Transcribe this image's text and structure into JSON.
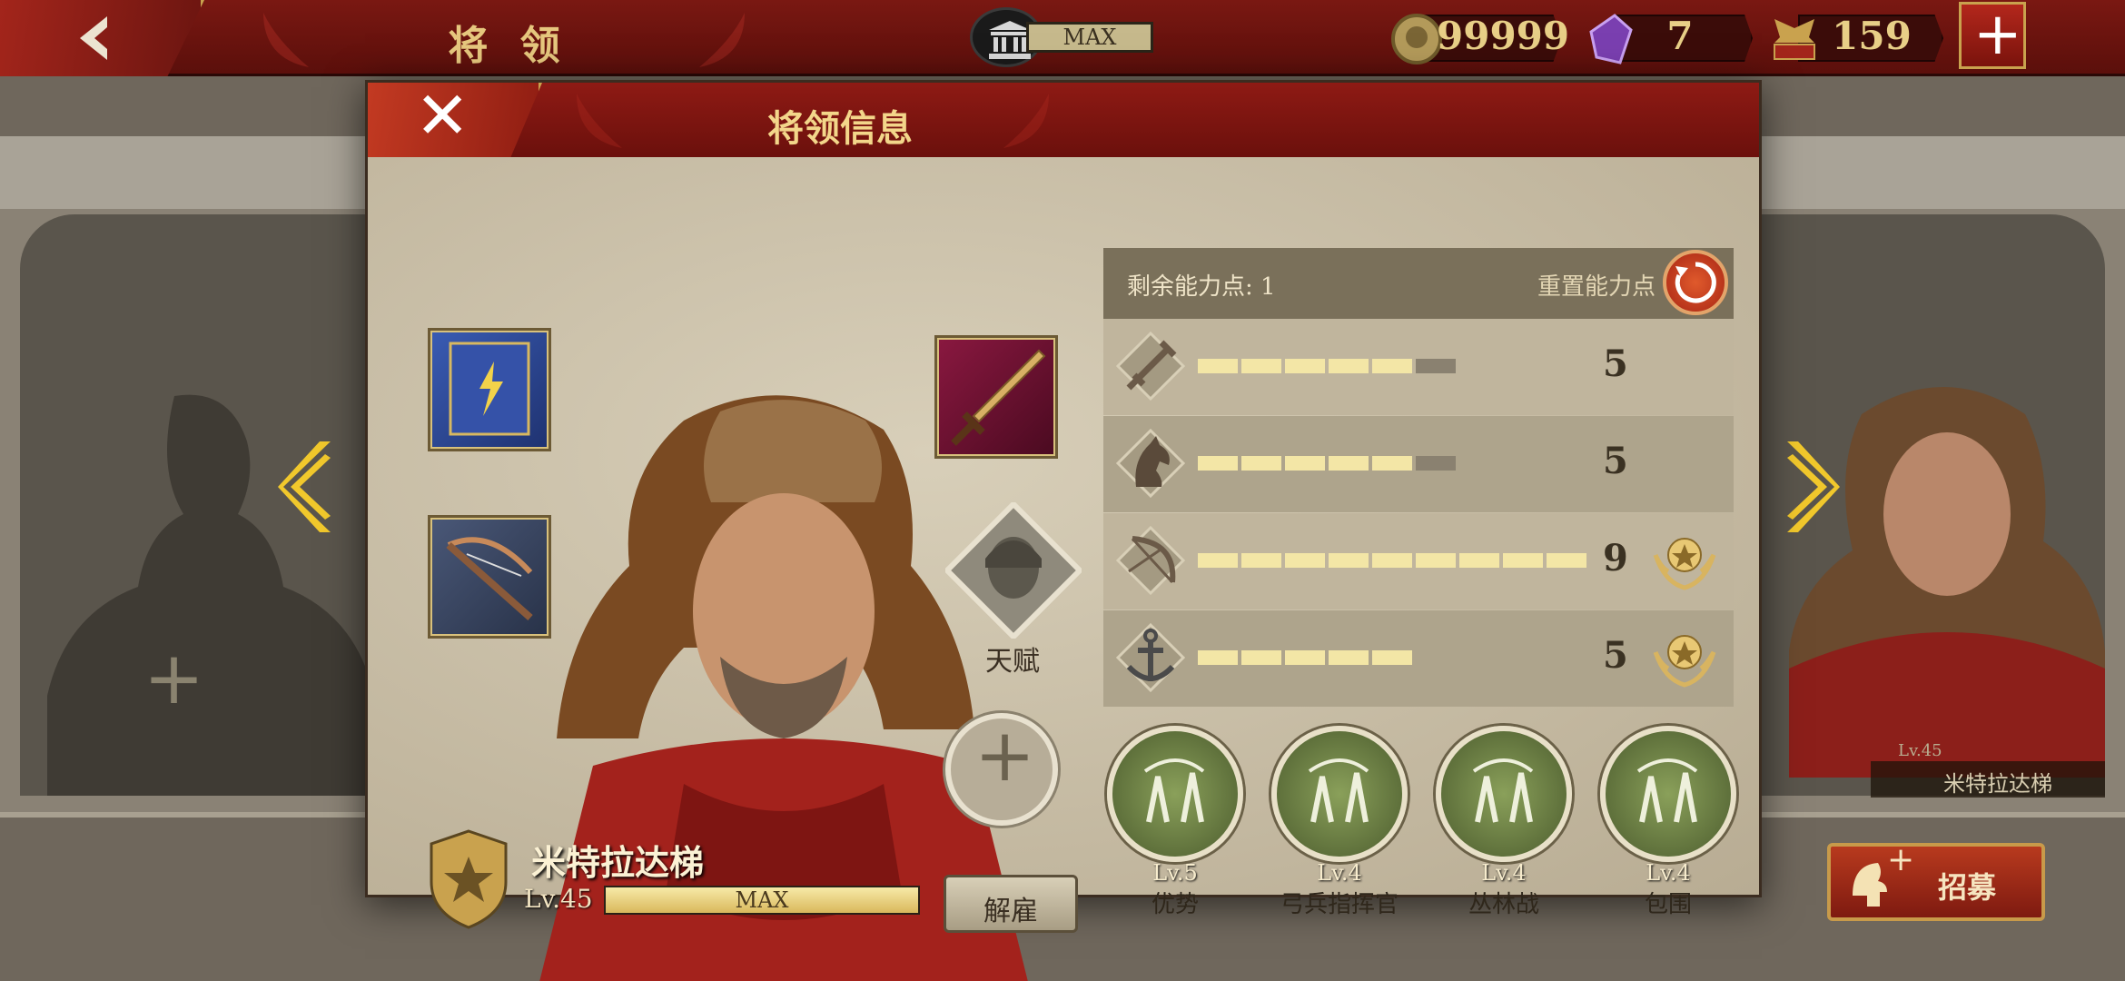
{
  "topbar": {
    "title": "将 领",
    "hq_level": "MAX",
    "gold": "99999",
    "gems": "7",
    "tokens": "159"
  },
  "modal": {
    "title": "将领信息"
  },
  "general": {
    "name": "米特拉达梯",
    "level": "Lv.45",
    "exp_label": "MAX",
    "dismiss_label": "解雇",
    "talent_label": "天赋"
  },
  "stats": {
    "remaining_points": "剩余能力点: 1",
    "reset_label": "重置能力点",
    "rows": [
      {
        "icon": "sword-icon",
        "value": "5",
        "filled": 5,
        "max": 6,
        "medal": false
      },
      {
        "icon": "horse-icon",
        "value": "5",
        "filled": 5,
        "max": 6,
        "medal": false
      },
      {
        "icon": "bow-icon",
        "value": "9",
        "filled": 9,
        "max": 9,
        "medal": true
      },
      {
        "icon": "anchor-icon",
        "value": "5",
        "filled": 5,
        "max": 5,
        "medal": true
      }
    ]
  },
  "skills": [
    {
      "level": "Lv.5",
      "name": "优势",
      "icon": "archers-icon"
    },
    {
      "level": "Lv.4",
      "name": "弓兵指挥官",
      "icon": "bow-commander-icon"
    },
    {
      "level": "Lv.4",
      "name": "丛林战",
      "icon": "forest-icon"
    },
    {
      "level": "Lv.4",
      "name": "包围",
      "icon": "encircle-icon"
    }
  ],
  "side": {
    "right_general_name": "米特拉达梯",
    "right_general_level": "Lv.45",
    "recruit_label": "招募"
  },
  "colors": {
    "header_red": "#7a1812",
    "gold": "#e6c77e",
    "stat_bar": "#f3e6a6"
  }
}
